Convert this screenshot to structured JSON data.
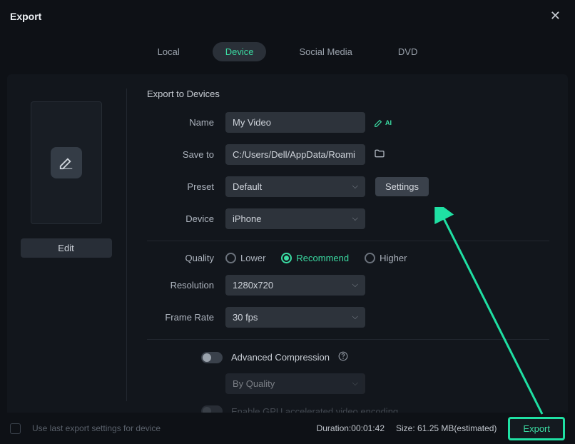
{
  "window": {
    "title": "Export"
  },
  "tabs": {
    "local": "Local",
    "device": "Device",
    "social": "Social Media",
    "dvd": "DVD"
  },
  "section": {
    "title": "Export to Devices"
  },
  "fields": {
    "name": {
      "label": "Name",
      "value": "My Video"
    },
    "saveto": {
      "label": "Save to",
      "value": "C:/Users/Dell/AppData/Roami"
    },
    "preset": {
      "label": "Preset",
      "value": "Default",
      "settings": "Settings"
    },
    "device": {
      "label": "Device",
      "value": "iPhone"
    },
    "quality": {
      "label": "Quality",
      "lower": "Lower",
      "recommend": "Recommend",
      "higher": "Higher"
    },
    "resolution": {
      "label": "Resolution",
      "value": "1280x720"
    },
    "framerate": {
      "label": "Frame Rate",
      "value": "30 fps"
    },
    "adv": {
      "label": "Advanced Compression",
      "mode": "By Quality"
    },
    "gpu": {
      "label": "Enable GPU accelerated video encoding"
    }
  },
  "ai": {
    "label": "AI"
  },
  "edit": {
    "label": "Edit"
  },
  "footer": {
    "use_last": "Use last export settings for device",
    "duration_label": "Duration:",
    "duration_value": "00:01:42",
    "size_label": "Size:",
    "size_value": "61.25 MB(estimated)",
    "export": "Export"
  }
}
